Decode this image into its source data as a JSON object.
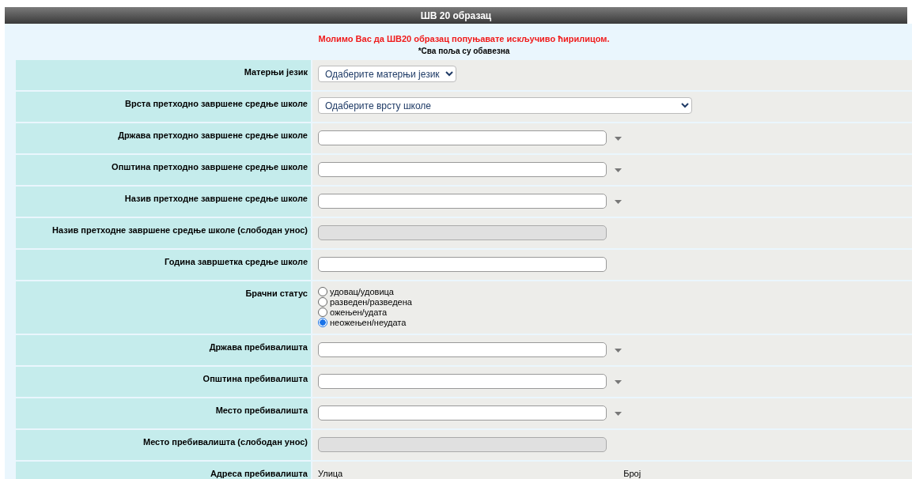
{
  "header": {
    "title": "ШВ 20 образац"
  },
  "notice": {
    "warning": "Молимо Вас да ШВ20 образац попуњавате искључиво ћирилицом.",
    "required_note": "*Сва поља су обавезна"
  },
  "rows": [
    {
      "kind": "select",
      "label": "Матерњи језик",
      "value": "Одаберите матерњи језик",
      "wide": false
    },
    {
      "kind": "select",
      "label": "Врста претходно завршене средње школе",
      "value": "Одаберите врсту школе",
      "wide": true
    },
    {
      "kind": "combo",
      "label": "Држава претходно завршене средње школе"
    },
    {
      "kind": "combo",
      "label": "Општина претходно завршене средње школе"
    },
    {
      "kind": "combo",
      "label": "Назив претходне завршене средње школе"
    },
    {
      "kind": "text",
      "label": "Назив претходне завршене средње школе (слободан унос)",
      "disabled": true
    },
    {
      "kind": "text",
      "label": "Година завршетка средње школе",
      "disabled": false
    },
    {
      "kind": "radio",
      "label": "Брачни статус",
      "options": [
        {
          "label": "удовац/удовица",
          "selected": false
        },
        {
          "label": "разведен/разведена",
          "selected": false
        },
        {
          "label": "ожењен/удата",
          "selected": false
        },
        {
          "label": "неожењен/неудата",
          "selected": true
        }
      ]
    },
    {
      "kind": "combo",
      "label": "Држава пребивалишта"
    },
    {
      "kind": "combo",
      "label": "Општина пребивалишта"
    },
    {
      "kind": "combo",
      "label": "Место пребивалишта"
    },
    {
      "kind": "text",
      "label": "Место пребивалишта (слободан унос)",
      "disabled": true
    },
    {
      "kind": "address",
      "label": "Адреса пребивалишта",
      "street_label": "Улица",
      "number_label": "Број"
    }
  ]
}
